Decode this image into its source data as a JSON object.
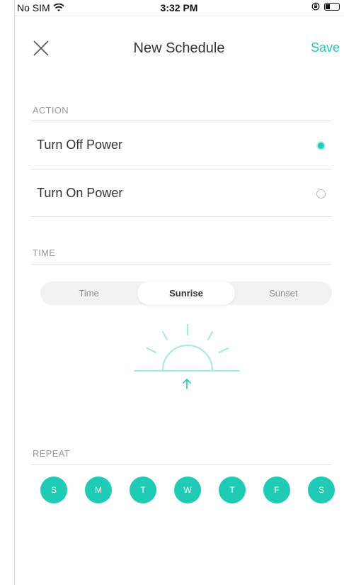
{
  "status_bar": {
    "carrier": "No SIM",
    "time": "3:32 PM"
  },
  "nav": {
    "title": "New Schedule",
    "save_label": "Save"
  },
  "action": {
    "label": "ACTION",
    "options": [
      {
        "label": "Turn Off Power",
        "selected": true
      },
      {
        "label": "Turn On Power",
        "selected": false
      }
    ]
  },
  "time": {
    "label": "TIME",
    "tabs": [
      {
        "label": "Time",
        "active": false
      },
      {
        "label": "Sunrise",
        "active": true
      },
      {
        "label": "Sunset",
        "active": false
      }
    ]
  },
  "repeat": {
    "label": "REPEAT",
    "days": [
      "S",
      "M",
      "T",
      "W",
      "T",
      "F",
      "S"
    ]
  },
  "colors": {
    "accent": "#1fcbb5",
    "accent_light": "#a8ebe2"
  },
  "icons": {
    "wifi": "wifi-icon",
    "lock": "orientation-lock-icon",
    "battery": "battery-icon",
    "close": "close-icon",
    "sunrise": "sunrise-icon"
  }
}
